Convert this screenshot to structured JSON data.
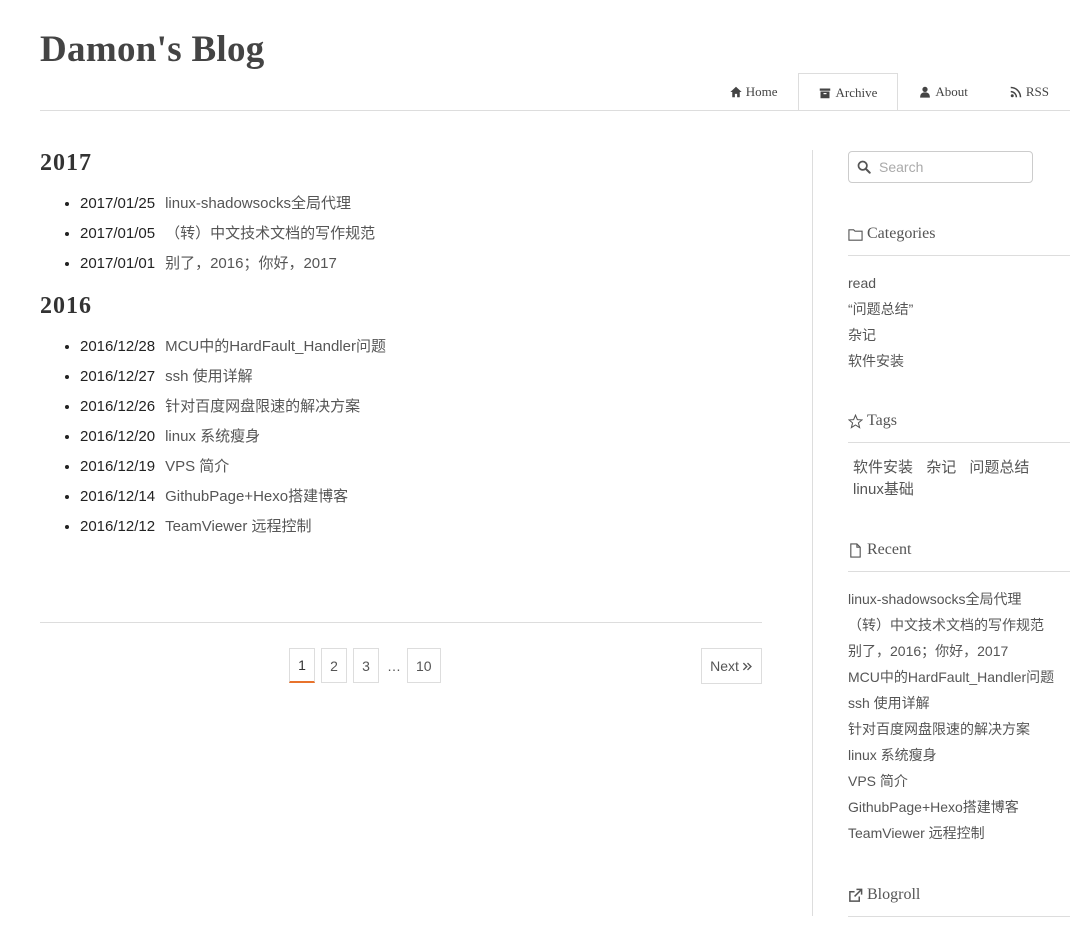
{
  "site": {
    "title": "Damon's Blog"
  },
  "nav": [
    {
      "label": "Home",
      "icon": "home-icon",
      "active": false
    },
    {
      "label": "Archive",
      "icon": "archive-icon",
      "active": true
    },
    {
      "label": "About",
      "icon": "user-icon",
      "active": false
    },
    {
      "label": "RSS",
      "icon": "rss-icon",
      "active": false
    }
  ],
  "archive": [
    {
      "year": "2017",
      "posts": [
        {
          "date": "2017/01/25",
          "title": "linux-shadowsocks全局代理"
        },
        {
          "date": "2017/01/05",
          "title": "（转）中文技术文档的写作规范"
        },
        {
          "date": "2017/01/01",
          "title": "别了，2016；你好，2017"
        }
      ]
    },
    {
      "year": "2016",
      "posts": [
        {
          "date": "2016/12/28",
          "title": "MCU中的HardFault_Handler问题"
        },
        {
          "date": "2016/12/27",
          "title": "ssh 使用详解"
        },
        {
          "date": "2016/12/26",
          "title": "针对百度网盘限速的解决方案"
        },
        {
          "date": "2016/12/20",
          "title": "linux 系统瘦身"
        },
        {
          "date": "2016/12/19",
          "title": "VPS 简介"
        },
        {
          "date": "2016/12/14",
          "title": "GithubPage+Hexo搭建博客"
        },
        {
          "date": "2016/12/12",
          "title": "TeamViewer 远程控制"
        }
      ]
    }
  ],
  "pagination": {
    "pages": [
      "1",
      "2",
      "3"
    ],
    "ellipsis": "…",
    "last": "10",
    "current": "1",
    "next_label": "Next",
    "accent": "#e8732c"
  },
  "sidebar": {
    "search": {
      "placeholder": "Search"
    },
    "categories": {
      "title": "Categories",
      "items": [
        "read",
        "“问题总结”",
        "杂记",
        "软件安装"
      ]
    },
    "tags": {
      "title": "Tags",
      "items": [
        "软件安装",
        "杂记",
        "问题总结",
        "linux基础"
      ]
    },
    "recent": {
      "title": "Recent",
      "items": [
        "linux-shadowsocks全局代理",
        "（转）中文技术文档的写作规范",
        "别了，2016；你好，2017",
        "MCU中的HardFault_Handler问题",
        "ssh 使用详解",
        "针对百度网盘限速的解决方案",
        "linux 系统瘦身",
        "VPS 简介",
        "GithubPage+Hexo搭建博客",
        "TeamViewer 远程控制"
      ]
    },
    "blogroll": {
      "title": "Blogroll"
    }
  }
}
